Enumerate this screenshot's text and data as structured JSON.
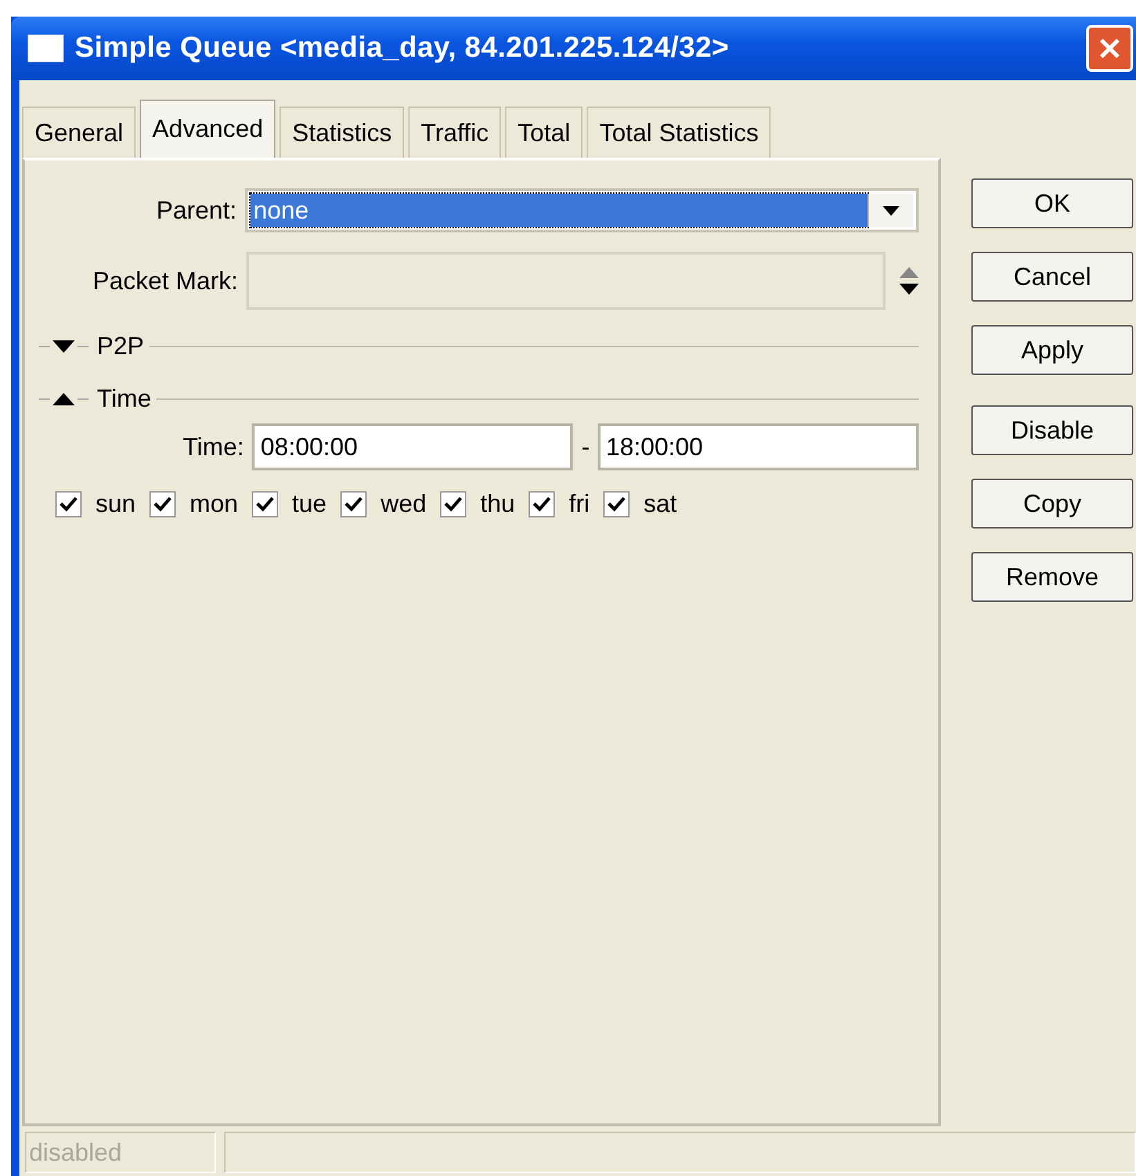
{
  "window": {
    "title": "Simple Queue <media_day, 84.201.225.124/32>"
  },
  "tabs": [
    {
      "label": "General",
      "selected": false
    },
    {
      "label": "Advanced",
      "selected": true
    },
    {
      "label": "Statistics",
      "selected": false
    },
    {
      "label": "Traffic",
      "selected": false
    },
    {
      "label": "Total",
      "selected": false
    },
    {
      "label": "Total Statistics",
      "selected": false
    }
  ],
  "parent": {
    "label": "Parent:",
    "value": "none"
  },
  "packet_mark": {
    "label": "Packet Mark:"
  },
  "sections": [
    {
      "title": "P2P",
      "expanded": false
    },
    {
      "title": "Time",
      "expanded": true
    }
  ],
  "time": {
    "label": "Time:",
    "from": "08:00:00",
    "separator": "-",
    "to": "18:00:00"
  },
  "days": [
    {
      "label": "sun",
      "checked": true
    },
    {
      "label": "mon",
      "checked": true
    },
    {
      "label": "tue",
      "checked": true
    },
    {
      "label": "wed",
      "checked": true
    },
    {
      "label": "thu",
      "checked": true
    },
    {
      "label": "fri",
      "checked": true
    },
    {
      "label": "sat",
      "checked": true
    }
  ],
  "button_groups": [
    [
      "OK",
      "Cancel",
      "Apply"
    ],
    [
      "Disable",
      "Copy",
      "Remove"
    ]
  ],
  "status_bar": [
    "disabled"
  ]
}
